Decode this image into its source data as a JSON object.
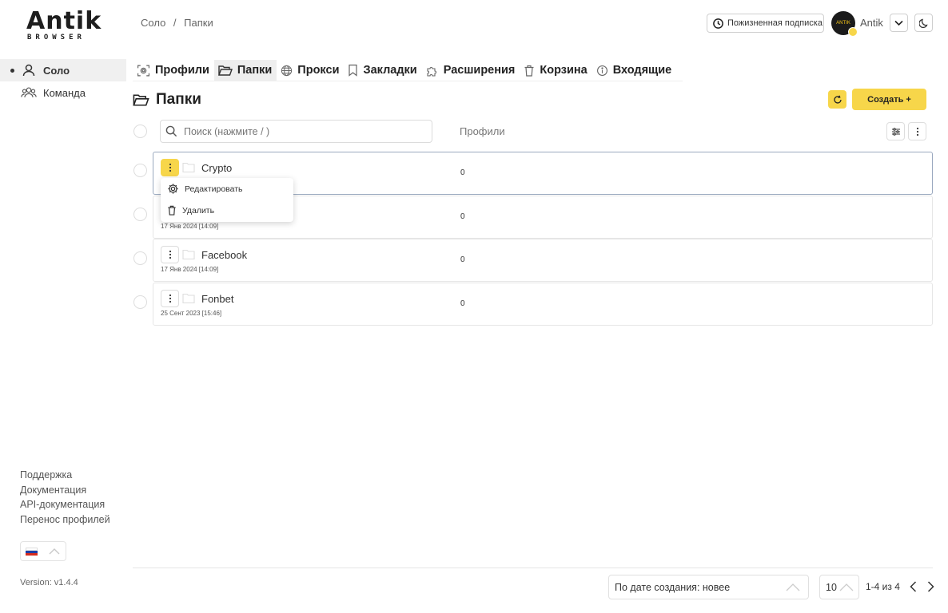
{
  "brand": {
    "name": "Antik",
    "subtitle": "BROWSER"
  },
  "sidebar": {
    "items": [
      {
        "label": "Соло",
        "icon": "user-icon",
        "active": true
      },
      {
        "label": "Команда",
        "icon": "team-icon",
        "active": false
      }
    ],
    "links": [
      "Поддержка",
      "Документация",
      "API-документация",
      "Перенос профилей"
    ],
    "language": "ru",
    "version": "Version: v1.4.4"
  },
  "header": {
    "breadcrumb": [
      "Соло",
      "/",
      "Папки"
    ],
    "subscription": "Пожизненная подписка",
    "user": "Antik",
    "avatar_text": "ANTIK"
  },
  "tabs": [
    {
      "label": "Профили",
      "icon": "fingerprint-icon"
    },
    {
      "label": "Папки",
      "icon": "folder-icon",
      "active": true
    },
    {
      "label": "Прокси",
      "icon": "globe-icon"
    },
    {
      "label": "Закладки",
      "icon": "bookmark-icon"
    },
    {
      "label": "Расширения",
      "icon": "puzzle-icon"
    },
    {
      "label": "Корзина",
      "icon": "trash-icon"
    },
    {
      "label": "Входящие",
      "icon": "info-icon"
    }
  ],
  "page": {
    "title": "Папки",
    "create_label": "Создать +",
    "search_placeholder": "Поиск (нажмите / )",
    "profiles_column": "Профили"
  },
  "folders": [
    {
      "name": "Crypto",
      "date": "",
      "profiles": "0"
    },
    {
      "name": "",
      "date": "17 Янв 2024 [14:09]",
      "profiles": "0"
    },
    {
      "name": "Facebook",
      "date": "17 Янв 2024 [14:09]",
      "profiles": "0"
    },
    {
      "name": "Fonbet",
      "date": "25 Сент 2023 [15:46]",
      "profiles": "0"
    }
  ],
  "context_menu": {
    "edit": "Редактировать",
    "delete": "Удалить"
  },
  "footer": {
    "sort": "По дате создания: новее",
    "page_size": "10",
    "range": "1-4 из 4"
  },
  "colors": {
    "accent": "#f7d64a",
    "selected_border": "#9aa9bf"
  }
}
